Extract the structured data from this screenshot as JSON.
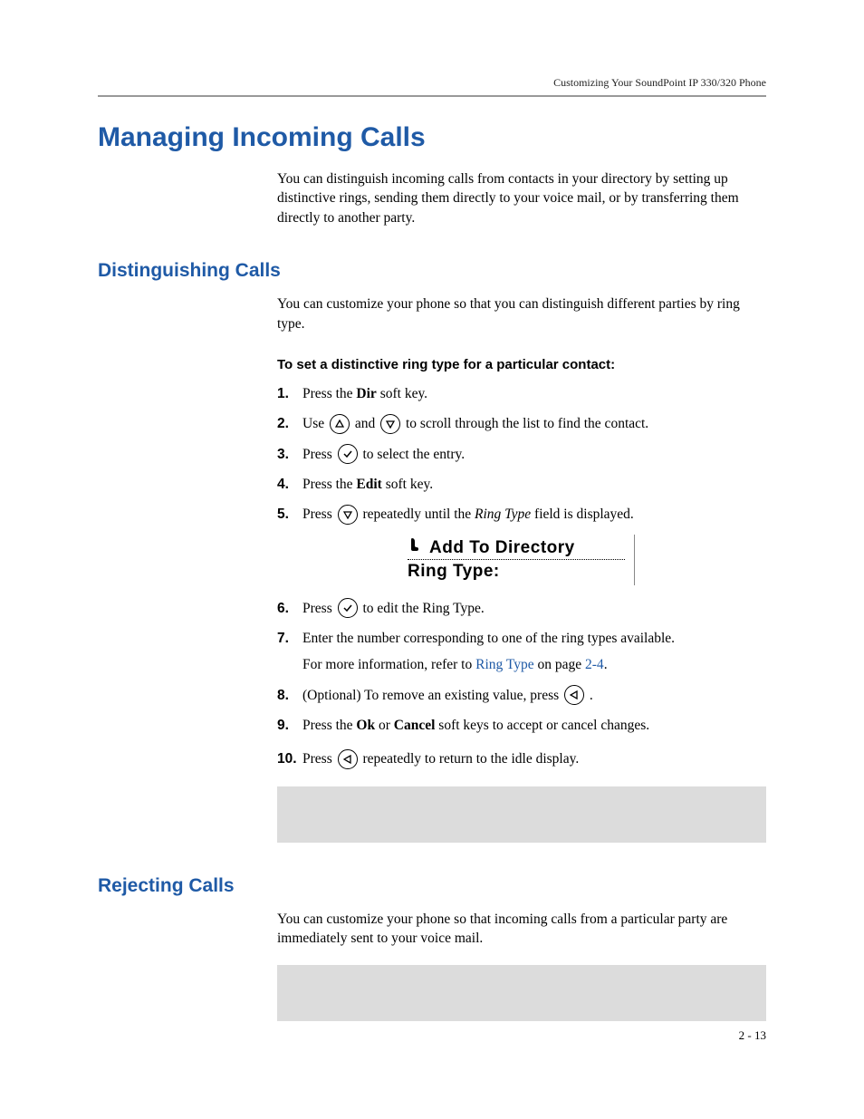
{
  "header": {
    "right": "Customizing Your SoundPoint IP 330/320 Phone"
  },
  "h1": "Managing Incoming Calls",
  "intro": "You can distinguish incoming calls from contacts in your directory by setting up distinctive rings, sending them directly to your voice mail, or by transferring them directly to another party.",
  "sectionA": {
    "title": "Distinguishing Calls",
    "para": "You can customize your phone so that you can distinguish different parties by ring type.",
    "subhead": "To set a distinctive ring type for a particular contact:",
    "steps": {
      "s1": {
        "num": "1.",
        "a": "Press the ",
        "b": "Dir",
        "c": " soft key."
      },
      "s2": {
        "num": "2.",
        "a": "Use ",
        "b": " and ",
        "c": " to scroll through the list to find the contact."
      },
      "s3": {
        "num": "3.",
        "a": "Press ",
        "b": " to select the entry."
      },
      "s4": {
        "num": "4.",
        "a": "Press the ",
        "b": "Edit",
        "c": " soft key."
      },
      "s5": {
        "num": "5.",
        "a": "Press ",
        "b": " repeatedly until the ",
        "c": "Ring Type",
        "d": " field is displayed."
      },
      "s6": {
        "num": "6.",
        "a": "Press ",
        "b": " to edit the Ring Type."
      },
      "s7": {
        "num": "7.",
        "a": "Enter the number corresponding to one of the ring types available.",
        "sub_a": "For more information, refer to ",
        "sub_link": "Ring Type",
        "sub_b": " on page ",
        "sub_pg": "2-4",
        "sub_c": "."
      },
      "s8": {
        "num": "8.",
        "a": "(Optional) To remove an existing value, press ",
        "b": "."
      },
      "s9": {
        "num": "9.",
        "a": "Press the ",
        "b": "Ok",
        "c": " or ",
        "d": "Cancel",
        "e": " soft keys to accept or cancel changes."
      },
      "s10": {
        "num": "10.",
        "a": "Press ",
        "b": " repeatedly to return to the idle display."
      }
    },
    "screenshot": {
      "line1": "Add To Directory",
      "line2": "Ring Type:"
    }
  },
  "sectionB": {
    "title": "Rejecting Calls",
    "para": "You can customize your phone so that incoming calls from a particular party are immediately sent to your voice mail."
  },
  "footer": "2 - 13"
}
